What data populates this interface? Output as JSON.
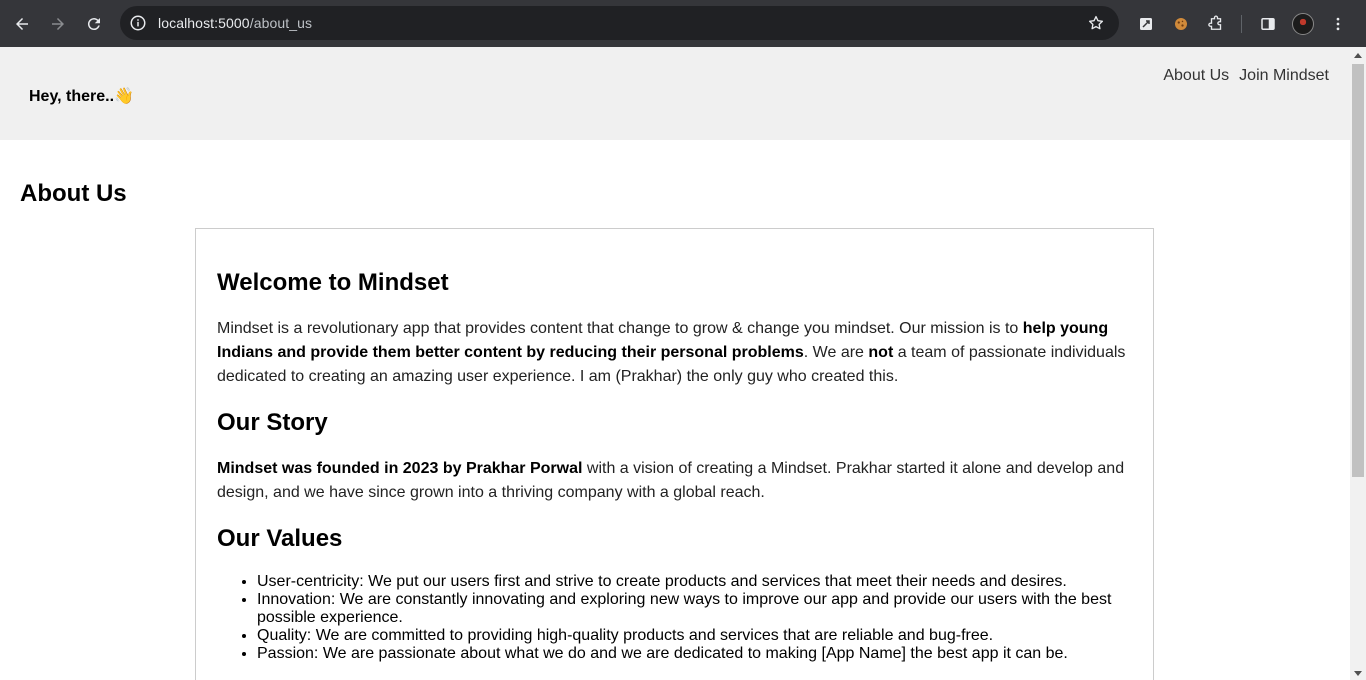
{
  "browser": {
    "url_host": "localhost:5000",
    "url_path": "/about_us",
    "icons": [
      "back-arrow-icon",
      "forward-arrow-icon",
      "reload-icon",
      "site-info-icon",
      "bookmark-star-icon",
      "extension-icon",
      "cookie-icon",
      "puzzle-extensions-icon",
      "side-panel-icon",
      "profile-avatar",
      "more-menu-icon"
    ]
  },
  "header": {
    "greeting": "Hey, there..👋",
    "nav": [
      {
        "label": "About Us"
      },
      {
        "label": "Join Mindset"
      }
    ]
  },
  "main": {
    "page_title": "About Us",
    "welcome": {
      "heading": "Welcome to Mindset",
      "text1": "Mindset is a revolutionary app that provides content that change to grow & change you mindset. Our mission is to ",
      "bold1": "help young Indians and provide them better content by reducing their personal problems",
      "text2": ". We are ",
      "bold2": "not",
      "text3": " a team of passionate individuals dedicated to creating an amazing user experience. I am (Prakhar) the only guy who created this."
    },
    "story": {
      "heading": "Our Story",
      "bold1": "Mindset was founded in 2023 by Prakhar Porwal",
      "text1": " with a vision of creating a Mindset. Prakhar started it alone and develop and design, and we have since grown into a thriving company with a global reach."
    },
    "values": {
      "heading": "Our Values",
      "items": [
        "User-centricity: We put our users first and strive to create products and services that meet their needs and desires.",
        "Innovation: We are constantly innovating and exploring new ways to improve our app and provide our users with the best possible experience.",
        "Quality: We are committed to providing high-quality products and services that are reliable and bug-free.",
        "Passion: We are passionate about what we do and we are dedicated to making [App Name] the best app it can be."
      ]
    }
  },
  "colors": {
    "chrome_bg": "#35363a",
    "omnibox_bg": "#202124",
    "header_bg": "#f0f0f0",
    "card_border": "#cccccc"
  }
}
